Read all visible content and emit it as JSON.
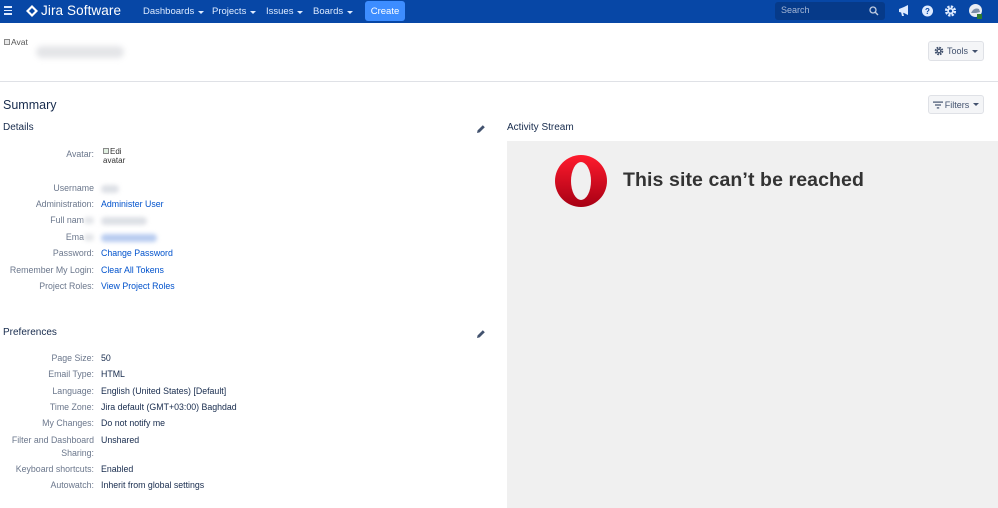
{
  "nav": {
    "product": "Jira Software",
    "menus": [
      "Dashboards",
      "Projects",
      "Issues",
      "Boards"
    ],
    "create_label": "Create",
    "search_placeholder": "Search"
  },
  "profile": {
    "avatar_alt": "Avat",
    "tools_label": "Tools"
  },
  "summary": {
    "title": "Summary",
    "filters_label": "Filters",
    "details_title": "Details",
    "preferences_title": "Preferences",
    "activity_title": "Activity Stream"
  },
  "details": {
    "avatar_label": "Avatar:",
    "avatar_alt": "Edi avatar",
    "username_label": "Username",
    "administration_label": "Administration:",
    "administration_value": "Administer User",
    "fullname_label": "Full nam",
    "email_label": "Ema",
    "password_label": "Password:",
    "password_value": "Change Password",
    "remember_label": "Remember My Login:",
    "remember_value": "Clear All Tokens",
    "roles_label": "Project Roles:",
    "roles_value": "View Project Roles"
  },
  "preferences": [
    {
      "label": "Page Size:",
      "value": "50"
    },
    {
      "label": "Email Type:",
      "value": "HTML"
    },
    {
      "label": "Language:",
      "value": "English (United States) [Default]"
    },
    {
      "label": "Time Zone:",
      "value": "Jira default (GMT+03:00) Baghdad"
    },
    {
      "label": "My Changes:",
      "value": "Do not notify me"
    },
    {
      "label": "Filter and Dashboard",
      "label2": "Sharing:",
      "value": "Unshared"
    },
    {
      "label": "Keyboard shortcuts:",
      "value": "Enabled"
    },
    {
      "label": "Autowatch:",
      "value": "Inherit from global settings"
    }
  ],
  "activity": {
    "error_message": "This site can’t be reached"
  },
  "colors": {
    "nav_bg": "#0747a6",
    "create_bg": "#3d8dff",
    "link": "#0052cc",
    "opera_red": "#e3131b"
  },
  "icons": {
    "menu": "hamburger-icon",
    "logo": "jira-logo-icon",
    "search": "search-icon",
    "notifications": "megaphone-icon",
    "help": "help-icon",
    "settings": "gear-icon",
    "profile": "avatar-icon",
    "edit": "pencil-icon",
    "filters": "filter-icon",
    "browser": "opera-logo-icon"
  }
}
